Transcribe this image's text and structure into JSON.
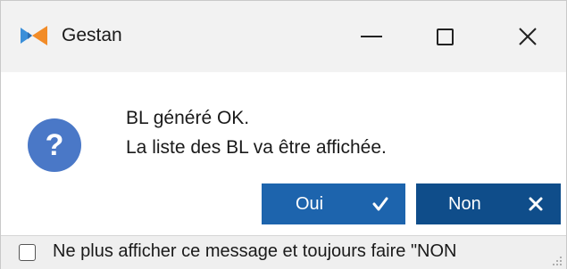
{
  "window": {
    "title": "Gestan",
    "icon": "gestan-logo-icon",
    "controls": [
      "minimize-icon",
      "maximize-icon",
      "close-icon"
    ]
  },
  "dialog": {
    "icon": "question-icon",
    "icon_glyph": "?",
    "icon_color": "#4a78c7",
    "message_line1": "BL généré OK.",
    "message_line2": "La liste des BL va être affichée."
  },
  "buttons": {
    "yes_label": "Oui",
    "yes_icon": "checkmark-icon",
    "no_label": "Non",
    "no_icon": "x-icon",
    "yes_color": "#1d64ad",
    "no_color": "#0f4d8a"
  },
  "footer": {
    "checkbox_checked": false,
    "checkbox_label": "Ne plus afficher ce message et toujours faire \"NON"
  }
}
